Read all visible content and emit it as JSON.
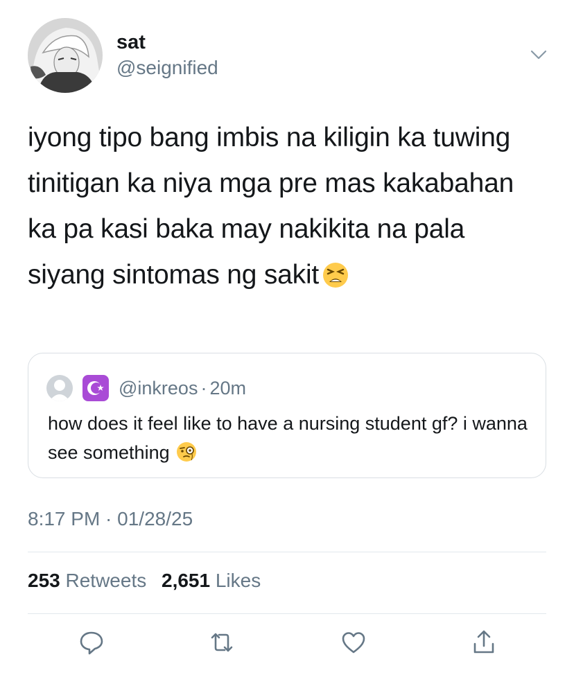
{
  "tweet": {
    "display_name": "sat",
    "handle": "@seignified",
    "text": "iyong tipo bang imbis na kiligin ka tuwing tinitigan ka niya mga pre mas kakabahan ka pa kasi baka may nakikita na pala siyang sintomas ng sakit",
    "text_emoji": "tired-face-emoji",
    "timestamp": "8:17 PM · 01/28/25"
  },
  "quoted": {
    "handle": "@inkreos",
    "separator": "·",
    "time": "20m",
    "text": "how does it feel like to have a nursing student gf? i wanna see something",
    "text_emoji": "face-with-monocle-emoji"
  },
  "stats": {
    "retweets_count": "253",
    "retweets_label": "Retweets",
    "likes_count": "2,651",
    "likes_label": "Likes"
  },
  "actions": [
    "reply-icon",
    "retweet-icon",
    "like-icon",
    "share-icon"
  ],
  "colors": {
    "text": "#14171a",
    "secondary": "#657786",
    "border": "#d9dee3",
    "badge": "#a94bd6"
  }
}
